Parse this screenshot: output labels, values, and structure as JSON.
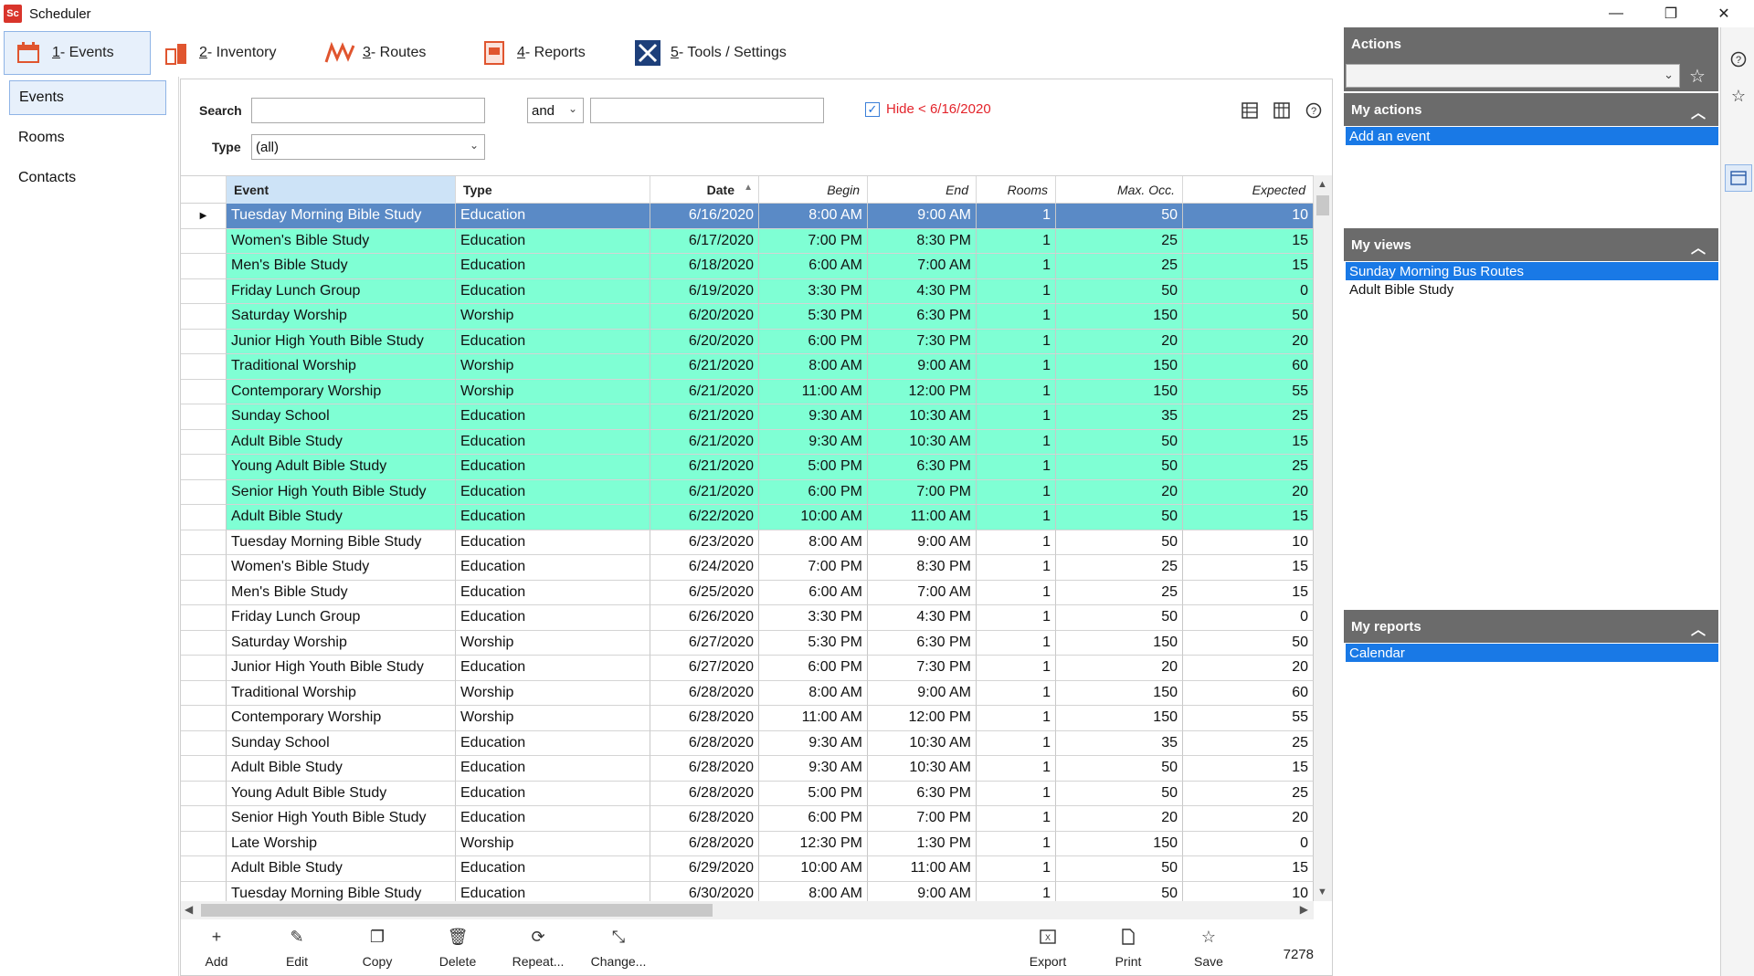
{
  "window": {
    "title": "Scheduler",
    "icon_label": "Sc",
    "controls": [
      "minimize",
      "restore",
      "close"
    ]
  },
  "ribbon": {
    "tabs": [
      {
        "num": "1",
        "label": " - Events",
        "icon": "events-icon",
        "active": true
      },
      {
        "num": "2",
        "label": " - Inventory",
        "icon": "inventory-icon",
        "active": false
      },
      {
        "num": "3",
        "label": " - Routes",
        "icon": "routes-icon",
        "active": false
      },
      {
        "num": "4",
        "label": " - Reports",
        "icon": "reports-icon",
        "active": false
      },
      {
        "num": "5",
        "label": " - Tools / Settings",
        "icon": "tools-icon",
        "active": false
      }
    ]
  },
  "nav": {
    "items": [
      "Events",
      "Rooms",
      "Contacts"
    ],
    "active": 0
  },
  "filter": {
    "search_label": "Search",
    "search_value": "",
    "conj": "and",
    "second_value": "",
    "hide_label": "Hide < 6/16/2020",
    "hide_checked": true,
    "type_label": "Type",
    "type_value": "(all)"
  },
  "grid": {
    "columns": [
      "Event",
      "Type",
      "Date",
      "Begin",
      "End",
      "Rooms",
      "Max. Occ.",
      "Expected"
    ],
    "sorted_column": "Date",
    "sort_dir": "ascending",
    "highlight_color": "#7fffd4",
    "selected_color": "#5a8ac6",
    "rows": [
      [
        "Tuesday Morning Bible Study",
        "Education",
        "6/16/2020",
        "8:00 AM",
        "9:00 AM",
        "1",
        "50",
        "10"
      ],
      [
        "Women's Bible Study",
        "Education",
        "6/17/2020",
        "7:00 PM",
        "8:30 PM",
        "1",
        "25",
        "15"
      ],
      [
        "Men's Bible Study",
        "Education",
        "6/18/2020",
        "6:00 AM",
        "7:00 AM",
        "1",
        "25",
        "15"
      ],
      [
        "Friday Lunch Group",
        "Education",
        "6/19/2020",
        "3:30 PM",
        "4:30 PM",
        "1",
        "50",
        "0"
      ],
      [
        "Saturday Worship",
        "Worship",
        "6/20/2020",
        "5:30 PM",
        "6:30 PM",
        "1",
        "150",
        "50"
      ],
      [
        "Junior High Youth Bible Study",
        "Education",
        "6/20/2020",
        "6:00 PM",
        "7:30 PM",
        "1",
        "20",
        "20"
      ],
      [
        "Traditional Worship",
        "Worship",
        "6/21/2020",
        "8:00 AM",
        "9:00 AM",
        "1",
        "150",
        "60"
      ],
      [
        "Contemporary Worship",
        "Worship",
        "6/21/2020",
        "11:00 AM",
        "12:00 PM",
        "1",
        "150",
        "55"
      ],
      [
        "Sunday School",
        "Education",
        "6/21/2020",
        "9:30 AM",
        "10:30 AM",
        "1",
        "35",
        "25"
      ],
      [
        "Adult Bible Study",
        "Education",
        "6/21/2020",
        "9:30 AM",
        "10:30 AM",
        "1",
        "50",
        "15"
      ],
      [
        "Young Adult Bible Study",
        "Education",
        "6/21/2020",
        "5:00 PM",
        "6:30 PM",
        "1",
        "50",
        "25"
      ],
      [
        "Senior High Youth Bible Study",
        "Education",
        "6/21/2020",
        "6:00 PM",
        "7:00 PM",
        "1",
        "20",
        "20"
      ],
      [
        "Adult Bible Study",
        "Education",
        "6/22/2020",
        "10:00 AM",
        "11:00 AM",
        "1",
        "50",
        "15"
      ],
      [
        "Tuesday Morning Bible Study",
        "Education",
        "6/23/2020",
        "8:00 AM",
        "9:00 AM",
        "1",
        "50",
        "10"
      ],
      [
        "Women's Bible Study",
        "Education",
        "6/24/2020",
        "7:00 PM",
        "8:30 PM",
        "1",
        "25",
        "15"
      ],
      [
        "Men's Bible Study",
        "Education",
        "6/25/2020",
        "6:00 AM",
        "7:00 AM",
        "1",
        "25",
        "15"
      ],
      [
        "Friday Lunch Group",
        "Education",
        "6/26/2020",
        "3:30 PM",
        "4:30 PM",
        "1",
        "50",
        "0"
      ],
      [
        "Saturday Worship",
        "Worship",
        "6/27/2020",
        "5:30 PM",
        "6:30 PM",
        "1",
        "150",
        "50"
      ],
      [
        "Junior High Youth Bible Study",
        "Education",
        "6/27/2020",
        "6:00 PM",
        "7:30 PM",
        "1",
        "20",
        "20"
      ],
      [
        "Traditional Worship",
        "Worship",
        "6/28/2020",
        "8:00 AM",
        "9:00 AM",
        "1",
        "150",
        "60"
      ],
      [
        "Contemporary Worship",
        "Worship",
        "6/28/2020",
        "11:00 AM",
        "12:00 PM",
        "1",
        "150",
        "55"
      ],
      [
        "Sunday School",
        "Education",
        "6/28/2020",
        "9:30 AM",
        "10:30 AM",
        "1",
        "35",
        "25"
      ],
      [
        "Adult Bible Study",
        "Education",
        "6/28/2020",
        "9:30 AM",
        "10:30 AM",
        "1",
        "50",
        "15"
      ],
      [
        "Young Adult Bible Study",
        "Education",
        "6/28/2020",
        "5:00 PM",
        "6:30 PM",
        "1",
        "50",
        "25"
      ],
      [
        "Senior High Youth Bible Study",
        "Education",
        "6/28/2020",
        "6:00 PM",
        "7:00 PM",
        "1",
        "20",
        "20"
      ],
      [
        "Late Worship",
        "Worship",
        "6/28/2020",
        "12:30 PM",
        "1:30 PM",
        "1",
        "150",
        "0"
      ],
      [
        "Adult Bible Study",
        "Education",
        "6/29/2020",
        "10:00 AM",
        "11:00 AM",
        "1",
        "50",
        "15"
      ],
      [
        "Tuesday Morning Bible Study",
        "Education",
        "6/30/2020",
        "8:00 AM",
        "9:00 AM",
        "1",
        "50",
        "10"
      ]
    ],
    "highlighted_count": 13
  },
  "toolbar": {
    "buttons": [
      {
        "label": "Add",
        "icon": "plus-icon"
      },
      {
        "label": "Edit",
        "icon": "pencil-icon"
      },
      {
        "label": "Copy",
        "icon": "copy-icon"
      },
      {
        "label": "Delete",
        "icon": "trash-icon"
      },
      {
        "label": "Repeat...",
        "icon": "repeat-icon"
      },
      {
        "label": "Change...",
        "icon": "change-icon"
      }
    ],
    "right_buttons": [
      {
        "label": "Export",
        "icon": "excel-icon"
      },
      {
        "label": "Print",
        "icon": "print-icon"
      },
      {
        "label": "Save",
        "icon": "star-icon"
      }
    ],
    "record_count": "7278"
  },
  "right_panel": {
    "actions_title": "Actions",
    "actions_combo": "",
    "my_actions_title": "My actions",
    "my_actions": [
      "Add an event"
    ],
    "my_views_title": "My views",
    "my_views": [
      "Sunday Morning Bus Routes",
      "Adult Bible Study"
    ],
    "my_reports_title": "My reports",
    "my_reports": [
      "Calendar"
    ]
  }
}
